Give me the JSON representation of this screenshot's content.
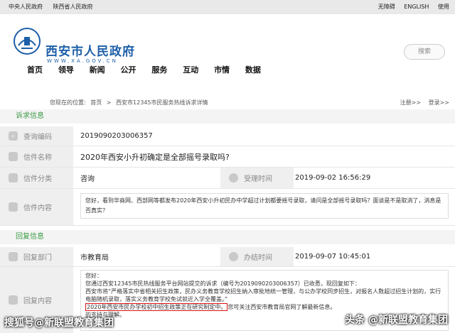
{
  "topbar": {
    "links_left": [
      "中央人民政府",
      "陕西省人民政府"
    ],
    "links_right": [
      "无障碍",
      "ENGLISH",
      "使用"
    ]
  },
  "header": {
    "site_title": "西安市人民政府",
    "site_url": "WWW.XA.GOV.CN",
    "search_placeholder": "搜索"
  },
  "nav": [
    "首页",
    "领导",
    "新闻",
    "公开",
    "服务",
    "互动",
    "市情",
    "数据"
  ],
  "breadcrumb": {
    "prefix": "您现在的位置:",
    "items": [
      "首页",
      ">",
      "西安市12345市民服务热线诉求详情"
    ],
    "register": "注册>>",
    "login": "登录>>"
  },
  "complaint": {
    "section_title": "诉求信息",
    "query_code_label": "查询编码",
    "query_code": "2019090203006357",
    "letter_name_label": "信件名称",
    "letter_name": "2020年西安小升初确定是全部摇号录取吗?",
    "category_label": "信件分类",
    "category": "咨询",
    "accepted_time_label": "受理时间",
    "accepted_time": "2019-09-02 16:56:29",
    "content_label": "信件内容",
    "content": "您好，看到华商网、西部网等都发布2020年西安小升初民办中学超过计划都要摇号录取，请问是全部摇号录取吗？面谈是不是取消了，消息是否真实？"
  },
  "reply": {
    "section_title": "回复信息",
    "department_label": "回复部门",
    "department": "市教育局",
    "completed_time_label": "办结时间",
    "completed_time": "2019-09-07 10:45:01",
    "content_label": "回复内容",
    "line1": "您好：",
    "line2": "您通过西安12345市民热线服务平台网站提交的诉求（编号为2019090203006357）已收悉，现回复如下：",
    "line3": "西安市将“严格落实中省相关招生政策，民办义务教育学校招生纳入审批地统一管理，与公办学校同步招生，对报名人数超过招生计划的，实行电脑随机录取，落实义务教育学校免试就近入学全覆盖。”",
    "highlight": "2020年西安市民办学校初中招生政策正在研究制定中。",
    "line4_rest": "您可关注西安市教育局官网了解最新信息。",
    "line5": "的支持与理解。"
  },
  "watermarks": {
    "left": "搜狐号@新联盟教育集团",
    "right": "头条 @新联盟教育集团"
  }
}
